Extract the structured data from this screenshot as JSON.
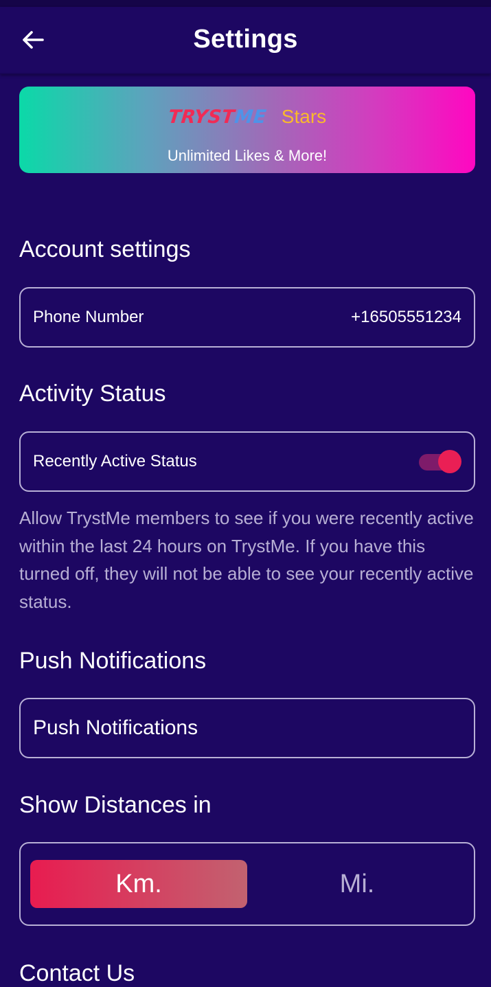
{
  "header": {
    "title": "Settings",
    "back_icon": "arrow-left-icon"
  },
  "promo": {
    "brand_part1": "TRYST",
    "brand_part2": "ME",
    "stars_label": "Stars",
    "subtitle": "Unlimited Likes & More!",
    "gradient_start": "#0bd9a8",
    "gradient_end": "#ff07c1"
  },
  "account_settings": {
    "title": "Account settings",
    "phone_label": "Phone Number",
    "phone_value": "+16505551234"
  },
  "activity_status": {
    "title": "Activity Status",
    "toggle_label": "Recently Active Status",
    "toggle_on": true,
    "description": "Allow TrystMe members to see if you were recently active within the last 24 hours on TrystMe. If you have this turned off, they will not be able to see your recently active status."
  },
  "push_notifications": {
    "title": "Push Notifications",
    "item_label": "Push Notifications"
  },
  "distances": {
    "title": "Show Distances in",
    "options": [
      "Km.",
      "Mi."
    ],
    "selected": "Km."
  },
  "contact": {
    "title": "Contact Us"
  },
  "colors": {
    "background": "#1d0762",
    "accent": "#ea1f55",
    "stars": "#f9b92c"
  }
}
